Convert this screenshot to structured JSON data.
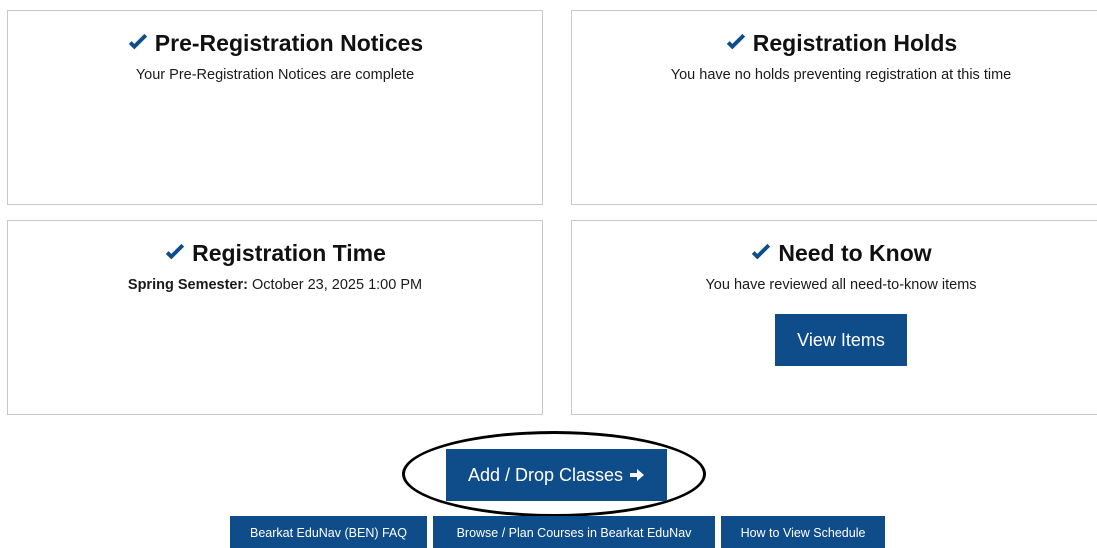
{
  "cards": {
    "notices": {
      "title": "Pre-Registration Notices",
      "body": "Your Pre-Registration Notices are complete"
    },
    "holds": {
      "title": "Registration Holds",
      "body": "You have no holds preventing registration at this time"
    },
    "time": {
      "title": "Registration Time",
      "term_label": "Spring Semester:",
      "term_value": " October 23, 2025 1:00 PM"
    },
    "know": {
      "title": "Need to Know",
      "body": "You have reviewed all need-to-know items",
      "button_label": "View Items"
    }
  },
  "actions": {
    "add_drop_label": "Add / Drop Classes",
    "links": {
      "faq": "Bearkat EduNav (BEN) FAQ",
      "browse": "Browse / Plan Courses in Bearkat EduNav",
      "schedule": "How to View Schedule"
    }
  },
  "icons": {
    "status": "check-icon",
    "add_drop": "arrow-right-icon"
  },
  "colors": {
    "accent": "#0f4c8a",
    "check": "#0f4c8a",
    "annotation": "#000000"
  }
}
